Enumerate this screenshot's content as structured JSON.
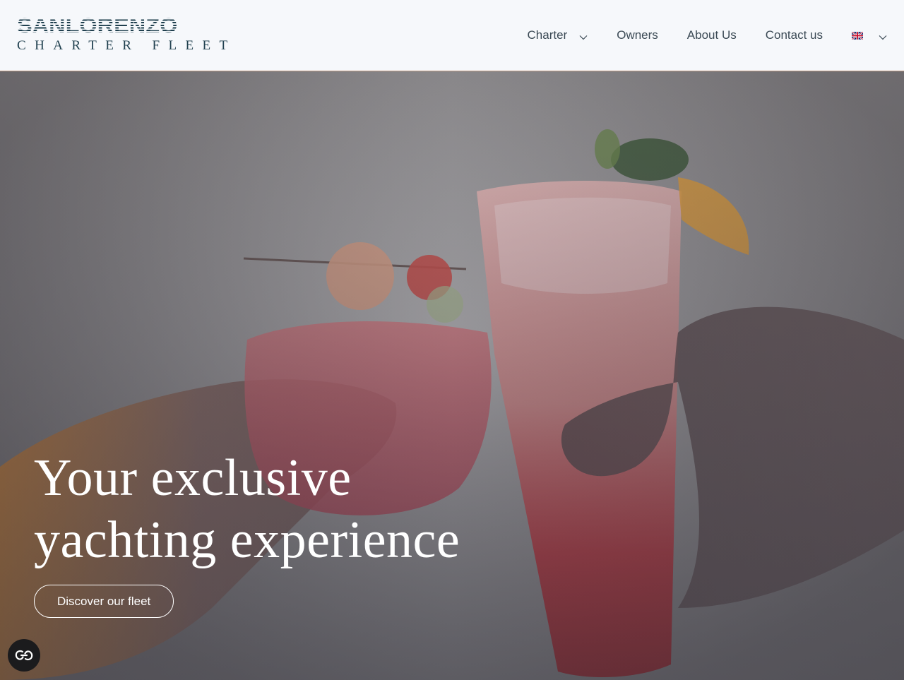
{
  "brand": {
    "name": "SANLORENZO",
    "subtitle": "CHARTER FLEET"
  },
  "nav": {
    "items": [
      {
        "label": "Charter",
        "has_dropdown": true
      },
      {
        "label": "Owners",
        "has_dropdown": false
      },
      {
        "label": "About Us",
        "has_dropdown": false
      },
      {
        "label": "Contact us",
        "has_dropdown": false
      }
    ],
    "language": {
      "icon": "uk-flag-icon",
      "has_dropdown": true
    }
  },
  "hero": {
    "title_line1": "Your exclusive",
    "title_line2": "yachting experience",
    "cta_label": "Discover our fleet"
  },
  "accessibility_button": {
    "icon": "accessibility-icon"
  },
  "colors": {
    "brand": "#1f3f4e",
    "nav_text": "#3b4a55",
    "header_bg": "#f6f8fb",
    "header_border": "#c9a48a",
    "hero_text": "#ffffff"
  }
}
